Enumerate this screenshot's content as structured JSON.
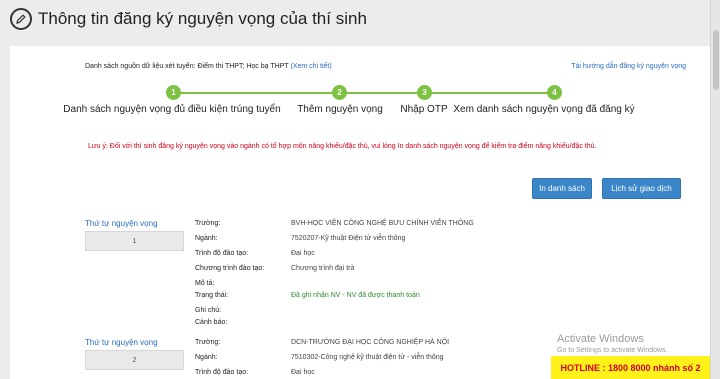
{
  "header": {
    "title": "Thông tin đăng ký nguyện vọng của thí sinh",
    "icon": "edit-icon"
  },
  "source": {
    "text": "Danh sách nguồn dữ liệu xét tuyển: Điểm thi THPT; Học bạ THPT",
    "detail_link": "(Xem chi tiết)",
    "guide_link": "Tải hướng dẫn đăng ký nguyện vọng"
  },
  "steps": [
    {
      "number": "1",
      "label": "Danh sách nguyện vọng đủ điều kiện trúng tuyển"
    },
    {
      "number": "2",
      "label": "Thêm nguyện vọng"
    },
    {
      "number": "3",
      "label": "Nhập OTP"
    },
    {
      "number": "4",
      "label": "Xem danh sách nguyện vọng đã đăng ký"
    }
  ],
  "warning": "Lưu ý: Đối với thí sinh đăng ký nguyện vọng vào ngành có tổ hợp môn năng khiếu/đặc thù, vui lòng In danh sách nguyện vọng để kiểm tra điểm năng khiếu/đặc thù.",
  "buttons": {
    "print": "In danh sách",
    "history": "Lịch sử giao dịch"
  },
  "labels": {
    "order": "Thứ tự nguyện vọng",
    "school": "Trường:",
    "major": "Ngành:",
    "level": "Trình độ đào tạo:",
    "program": "Chương trình đào tạo:",
    "description": "Mô tả:",
    "status": "Trạng thái:",
    "note": "Ghi chú:",
    "alert": "Cảnh báo:"
  },
  "entries": [
    {
      "order": "1",
      "school": "BVH-HỌC VIỆN CÔNG NGHỆ BƯU CHÍNH VIỄN THÔNG",
      "major": "7520207-Kỹ thuật Điện tử viễn thông",
      "level": "Đại học",
      "program": "Chương trình đại trà",
      "description": "",
      "status": "Đã ghi nhận NV - NV đã được thanh toán",
      "note": "",
      "alert": ""
    },
    {
      "order": "2",
      "school": "DCN-TRƯỜNG ĐẠI HỌC CÔNG NGHIỆP HÀ NỘI",
      "major": "7510302-Công nghệ kỹ thuật điện tử - viễn thông",
      "level": "Đại học"
    }
  ],
  "watermark": {
    "title": "Activate Windows",
    "subtitle": "Go to Settings to activate Windows."
  },
  "hotline": "HOTLINE : 1800 8000 nhánh số 2",
  "colors": {
    "accent": "#3a86c8",
    "step": "#7dc242",
    "warning": "#d0021b",
    "status_ok": "#2e8b2e",
    "hotline_bg": "#fff21a"
  }
}
